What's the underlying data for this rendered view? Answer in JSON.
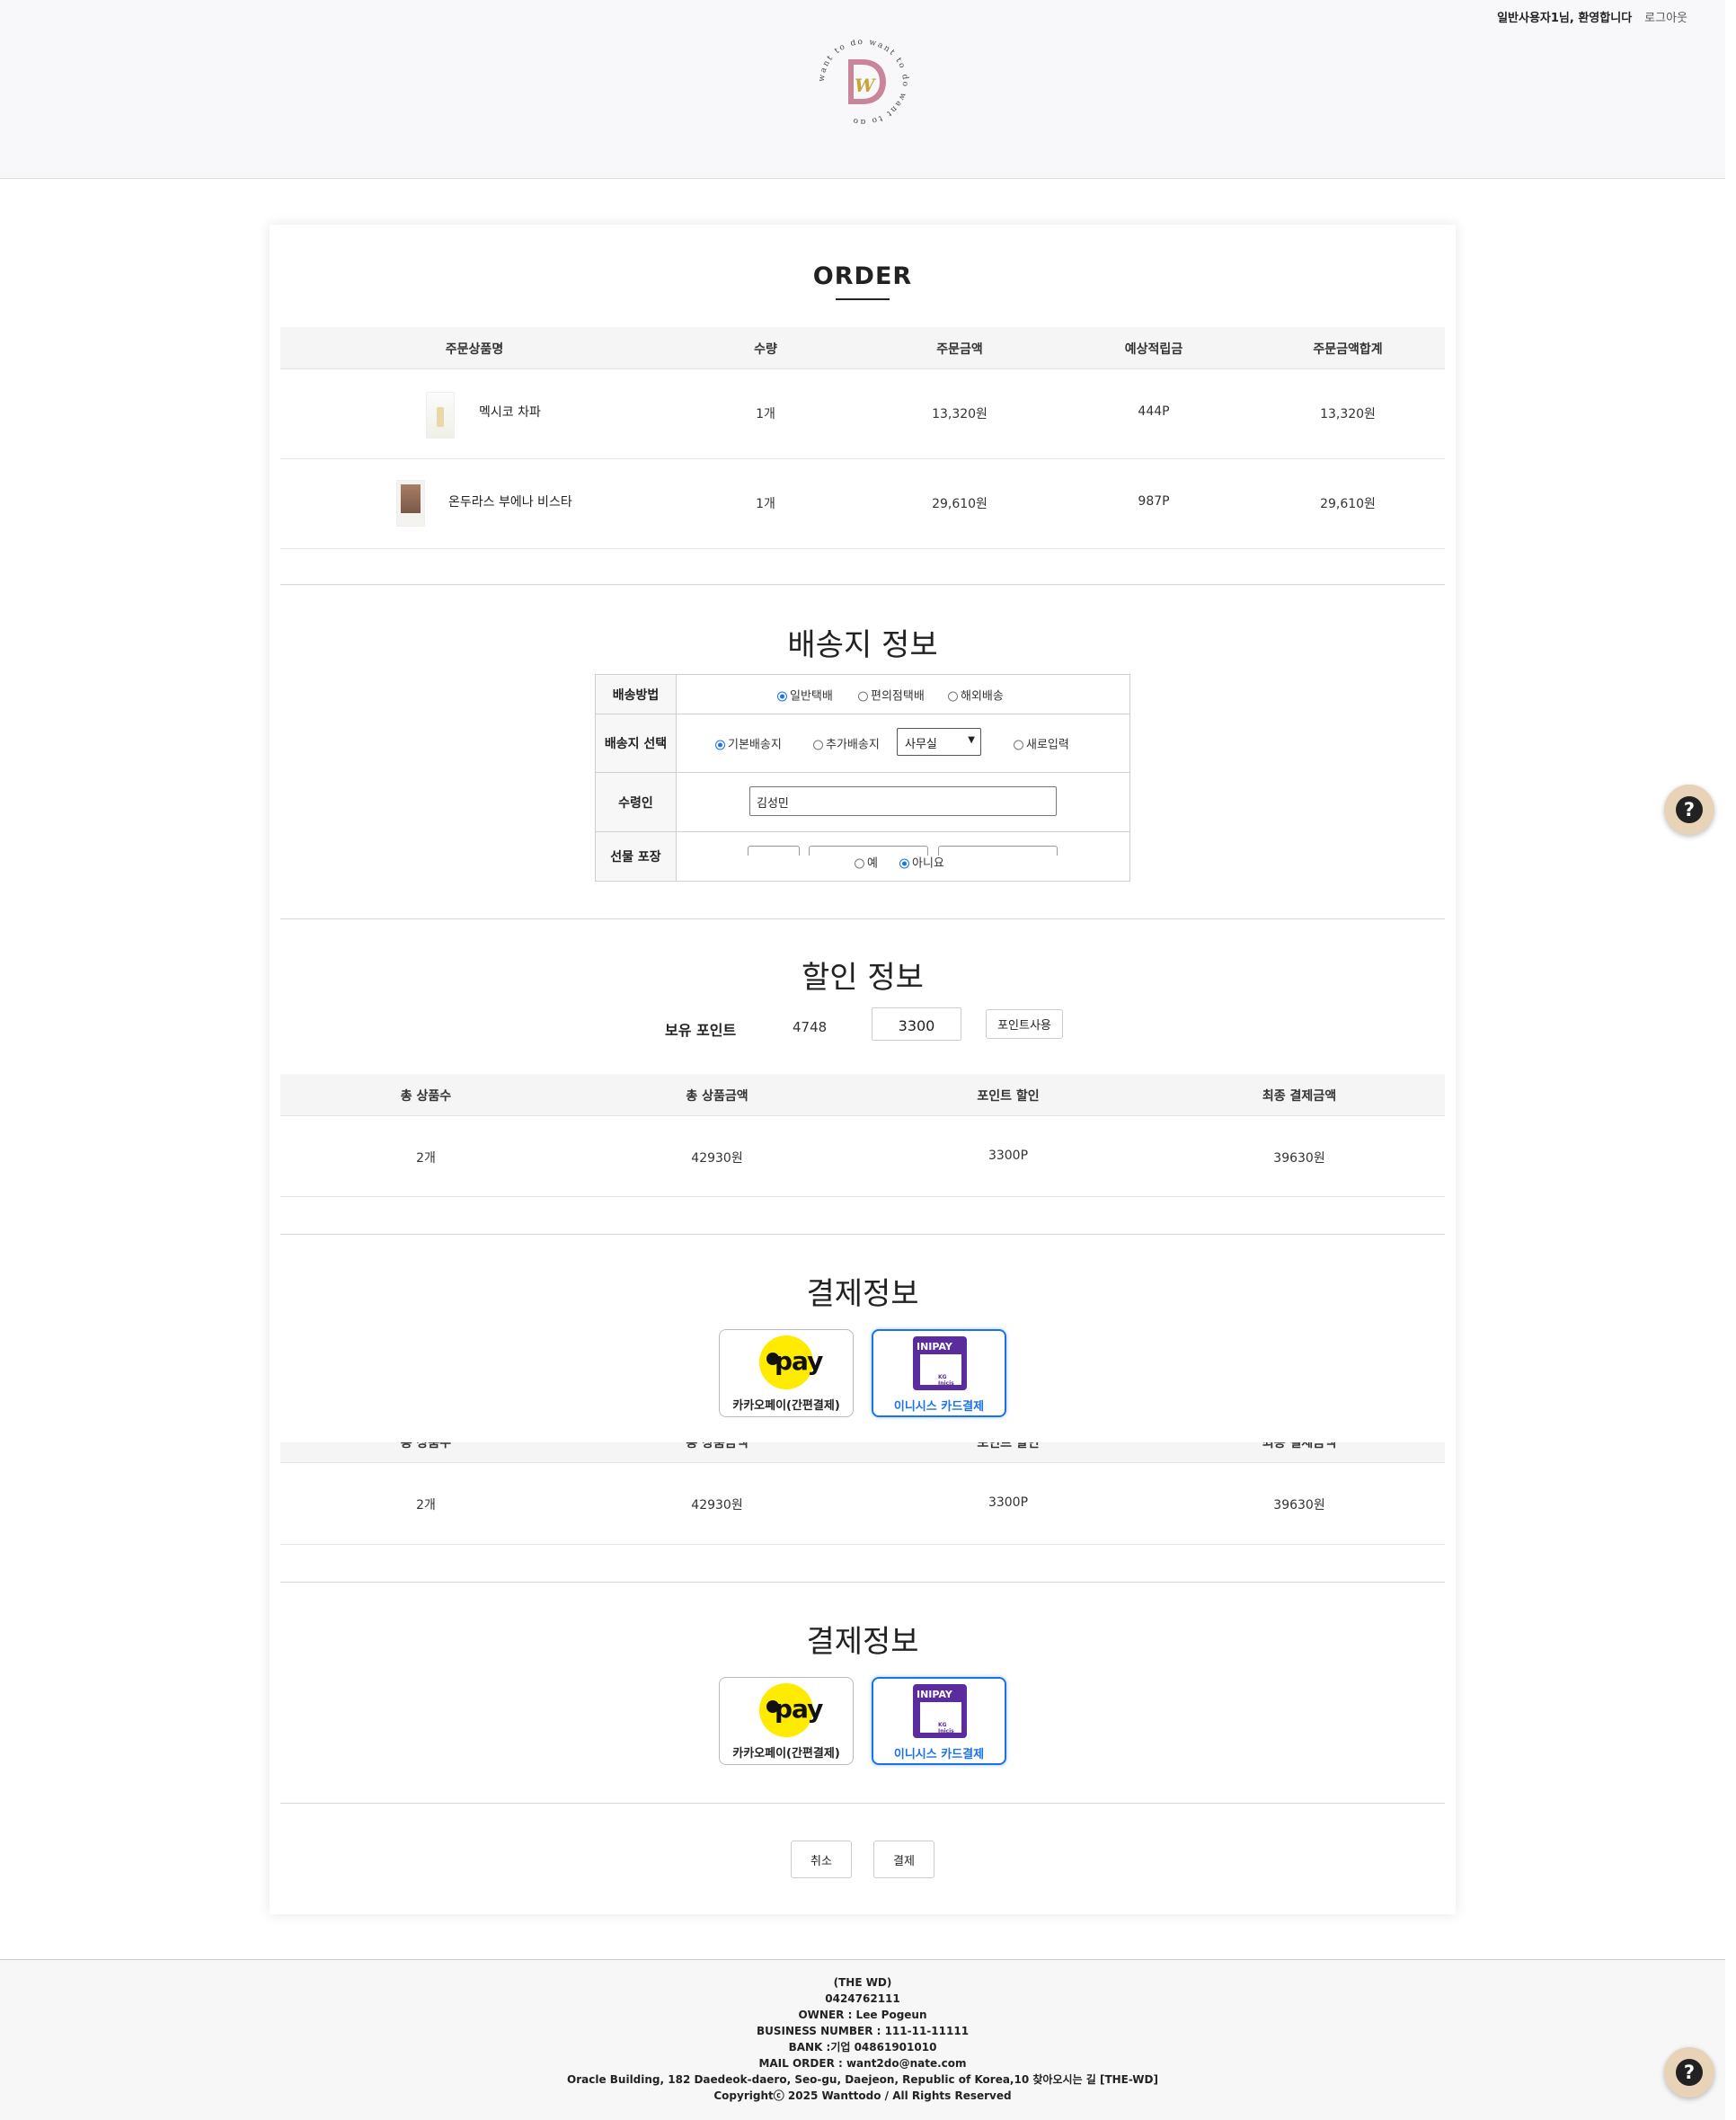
{
  "header": {
    "user_greeting": "일반사용자1님, 환영합니다",
    "logout_label": "로그아웃",
    "logo_letters": "WD",
    "logo_ring_text": "want to do want to do want to do"
  },
  "order": {
    "title": "ORDER",
    "columns": [
      "주문상품명",
      "수량",
      "주문금액",
      "예상적립금",
      "주문금액합계"
    ],
    "items": [
      {
        "name": "멕시코 차파",
        "qty": "1개",
        "price": "13,320원",
        "points": "444P",
        "total": "13,320원"
      },
      {
        "name": "온두라스 부에나 비스타",
        "qty": "1개",
        "price": "29,610원",
        "points": "987P",
        "total": "29,610원"
      }
    ]
  },
  "shipping": {
    "title": "배송지 정보",
    "method_label": "배송방법",
    "method_options": [
      "일반택배",
      "편의점택배",
      "해외배송"
    ],
    "address_label": "배송지 선택",
    "address_options": [
      "기본배송지",
      "추가배송지",
      "새로입력"
    ],
    "address_select_value": "사무실",
    "receiver_label": "수령인",
    "receiver_value": "김성민",
    "gift_label": "선물 포장",
    "gift_options": [
      "예",
      "아니요"
    ]
  },
  "discount": {
    "title": "할인 정보",
    "points_label": "보유 포인트",
    "points_value": "4748",
    "points_input": "3300",
    "use_points_button": "포인트사용",
    "columns": [
      "총 상품수",
      "총 상품금액",
      "포인트 할인",
      "최종 결제금액"
    ],
    "summary": {
      "count": "2개",
      "amount": "42930원",
      "discount": "3300P",
      "final": "39630원"
    }
  },
  "payment": {
    "title": "결제정보",
    "kakao_label": "카카오페이(간편결제)",
    "kakao_logo_text": "pay",
    "inicis_label": "이니시스 카드결제",
    "inicis_logo_text": "INIPAY",
    "inicis_sub_text": "KG Inicis"
  },
  "actions": {
    "cancel": "취소",
    "pay": "결제"
  },
  "footer": {
    "lines": [
      "(THE WD)",
      "0424762111",
      "OWNER : Lee Pogeun",
      "BUSINESS NUMBER : 111-11-11111",
      "BANK :기업 04861901010",
      "MAIL ORDER : want2do@nate.com",
      "Oracle Building, 182 Daedeok-daero, Seo-gu, Daejeon, Republic of Korea,10 찾아오시는 길 [THE-WD]",
      "Copyrightⓒ 2025 Wanttodo / All Rights Reserved"
    ]
  },
  "help_icon_glyph": "?",
  "colors": {
    "accent": "#1a73e8",
    "kakao_yellow": "#ffeb00",
    "inicis_purple": "#5b2c9e",
    "help_bg": "#e8d2b8"
  }
}
